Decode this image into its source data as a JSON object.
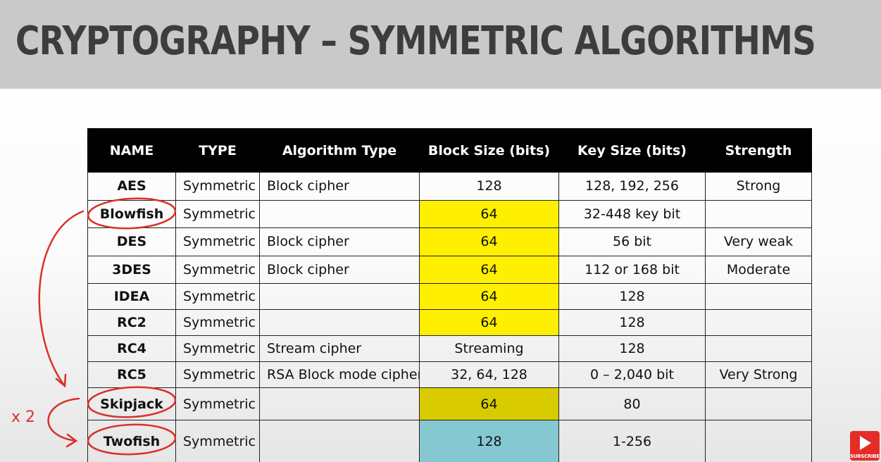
{
  "title": "CRYPTOGRAPHY – SYMMETRIC ALGORITHMS",
  "annotation": {
    "multiplier": "x 2"
  },
  "subscribe_label": "SUBSCRIBE",
  "colors": {
    "highlight_yellow": "#ffef00",
    "highlight_teal": "#86c8d2",
    "annotation_red": "#d8322a",
    "header_bg": "#000000",
    "title_band": "#c9c9c9"
  },
  "table": {
    "headers": [
      "NAME",
      "TYPE",
      "Algorithm Type",
      "Block Size (bits)",
      "Key Size (bits)",
      "Strength"
    ],
    "rows": [
      {
        "name": "AES",
        "type": "Symmetric",
        "algorithm_type": "Block cipher",
        "block_size": "128",
        "key_size": "128, 192, 256",
        "strength": "Strong",
        "highlight": ""
      },
      {
        "name": "Blowfish",
        "type": "Symmetric",
        "algorithm_type": "",
        "block_size": "64",
        "key_size": "32-448 key bit",
        "strength": "",
        "highlight": "yellow"
      },
      {
        "name": "DES",
        "type": "Symmetric",
        "algorithm_type": "Block cipher",
        "block_size": "64",
        "key_size": "56 bit",
        "strength": "Very weak",
        "highlight": "yellow"
      },
      {
        "name": "3DES",
        "type": "Symmetric",
        "algorithm_type": "Block cipher",
        "block_size": "64",
        "key_size": "112 or 168 bit",
        "strength": "Moderate",
        "highlight": "yellow"
      },
      {
        "name": "IDEA",
        "type": "Symmetric",
        "algorithm_type": "",
        "block_size": "64",
        "key_size": "128",
        "strength": "",
        "highlight": "yellow"
      },
      {
        "name": "RC2",
        "type": "Symmetric",
        "algorithm_type": "",
        "block_size": "64",
        "key_size": "128",
        "strength": "",
        "highlight": "yellow"
      },
      {
        "name": "RC4",
        "type": "Symmetric",
        "algorithm_type": "Stream cipher",
        "block_size": "Streaming",
        "key_size": "128",
        "strength": "",
        "highlight": ""
      },
      {
        "name": "RC5",
        "type": "Symmetric",
        "algorithm_type": "RSA Block mode cipher",
        "block_size": "32, 64, 128",
        "key_size": "0 – 2,040 bit",
        "strength": "Very Strong",
        "highlight": ""
      },
      {
        "name": "Skipjack",
        "type": "Symmetric",
        "algorithm_type": "",
        "block_size": "64",
        "key_size": "80",
        "strength": "",
        "highlight": "yellow"
      },
      {
        "name": "Twofish",
        "type": "Symmetric",
        "algorithm_type": "",
        "block_size": "128",
        "key_size": "1-256",
        "strength": "",
        "highlight": "teal"
      }
    ]
  }
}
